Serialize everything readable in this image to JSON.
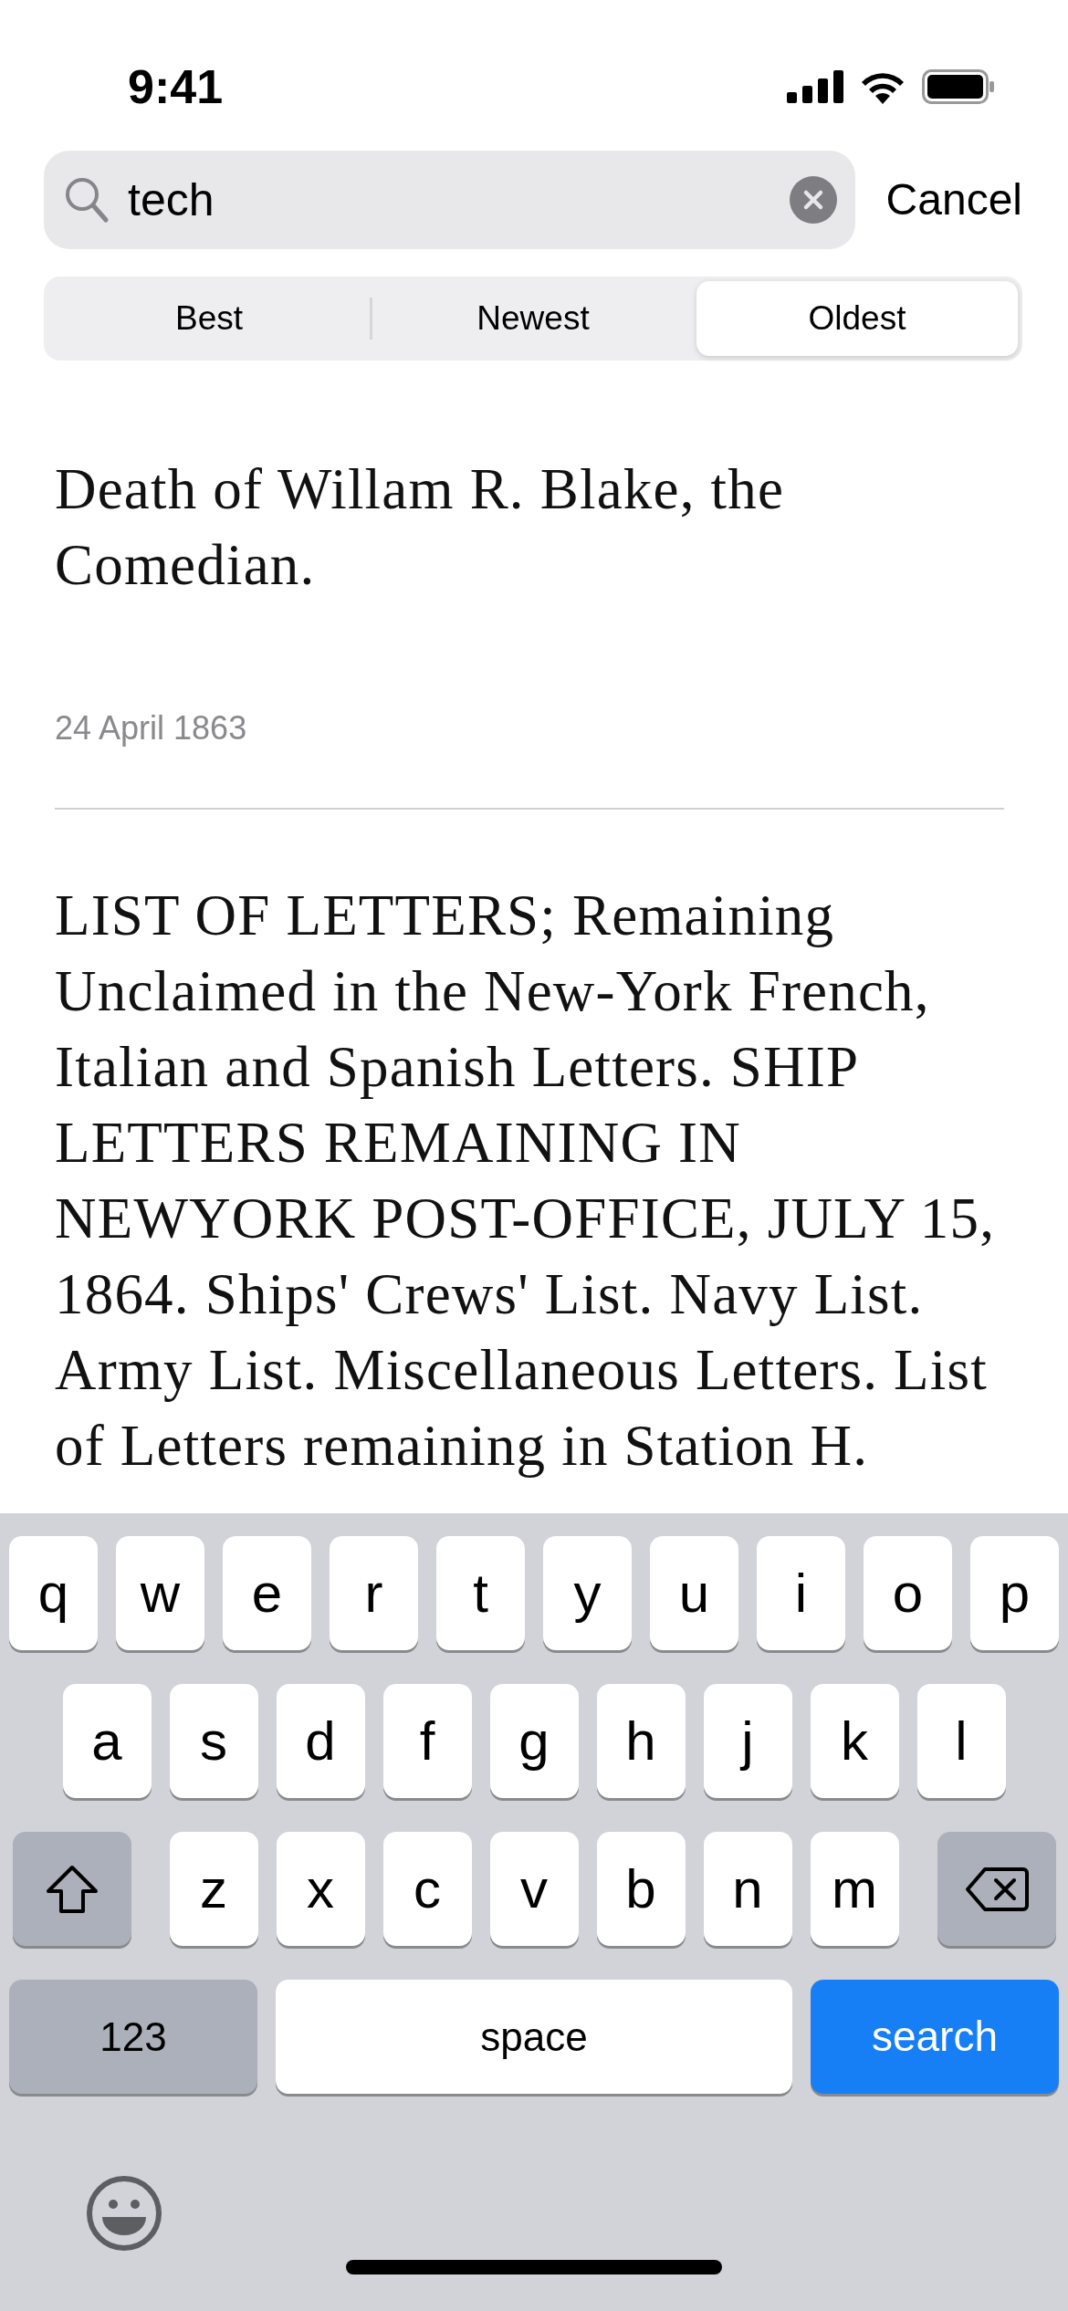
{
  "status_bar": {
    "time": "9:41"
  },
  "search": {
    "value": "tech",
    "cancel": "Cancel"
  },
  "segments": [
    {
      "label": "Best",
      "selected": false
    },
    {
      "label": "Newest",
      "selected": false
    },
    {
      "label": "Oldest",
      "selected": true
    }
  ],
  "articles": [
    {
      "title": "Death of Willam R. Blake, the Comedian.",
      "date": "24 April 1863"
    },
    {
      "title": "LIST OF LETTERS; Remaining Unclaimed in the New-York French, Italian and Spanish Letters. SHIP LETTERS REMAINING IN NEWYORK POST-OFFICE, JULY 15, 1864. Ships' Crews' List. Navy List. Army List. Miscellaneous Letters. List of Letters remaining in Station H."
    }
  ],
  "keyboard": {
    "rows": [
      [
        {
          "kind": "letter",
          "label": "q"
        },
        {
          "kind": "letter",
          "label": "w"
        },
        {
          "kind": "letter",
          "label": "e"
        },
        {
          "kind": "letter",
          "label": "r"
        },
        {
          "kind": "letter",
          "label": "t"
        },
        {
          "kind": "letter",
          "label": "y"
        },
        {
          "kind": "letter",
          "label": "u"
        },
        {
          "kind": "letter",
          "label": "i"
        },
        {
          "kind": "letter",
          "label": "o"
        },
        {
          "kind": "letter",
          "label": "p"
        }
      ],
      [
        {
          "kind": "letter",
          "label": "a"
        },
        {
          "kind": "letter",
          "label": "s"
        },
        {
          "kind": "letter",
          "label": "d"
        },
        {
          "kind": "letter",
          "label": "f"
        },
        {
          "kind": "letter",
          "label": "g"
        },
        {
          "kind": "letter",
          "label": "h"
        },
        {
          "kind": "letter",
          "label": "j"
        },
        {
          "kind": "letter",
          "label": "k"
        },
        {
          "kind": "letter",
          "label": "l"
        }
      ],
      [
        {
          "kind": "shift"
        },
        {
          "kind": "letter",
          "label": "z"
        },
        {
          "kind": "letter",
          "label": "x"
        },
        {
          "kind": "letter",
          "label": "c"
        },
        {
          "kind": "letter",
          "label": "v"
        },
        {
          "kind": "letter",
          "label": "b"
        },
        {
          "kind": "letter",
          "label": "n"
        },
        {
          "kind": "letter",
          "label": "m"
        },
        {
          "kind": "backspace"
        }
      ]
    ],
    "bottom_row": {
      "numbers_key": "123",
      "space_key": "space",
      "action_key": "search"
    }
  }
}
